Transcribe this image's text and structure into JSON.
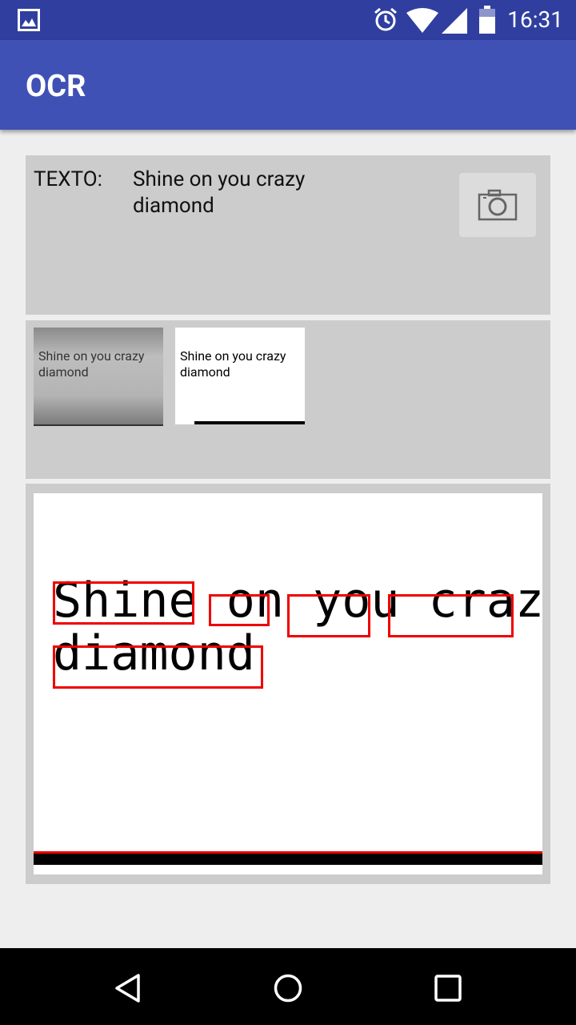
{
  "status_bar": {
    "time": "16:31",
    "icons": [
      "image-icon",
      "alarm-icon",
      "wifi-icon",
      "signal-icon",
      "battery-icon"
    ]
  },
  "app_bar": {
    "title": "OCR"
  },
  "result_panel": {
    "label": "TEXTO:",
    "text": "Shine on you crazy diamond",
    "camera_icon": "camera-icon"
  },
  "thumbnails": [
    {
      "name": "original-photo",
      "caption": "Shine on you crazy diamond"
    },
    {
      "name": "processed-image",
      "caption": "Shine on you crazy diamond"
    }
  ],
  "detection_image": {
    "words": [
      "Shine",
      "on",
      "you",
      "crazy",
      "diamond"
    ],
    "box_color": "#e00000"
  },
  "nav_bar": {
    "buttons": [
      "back-icon",
      "home-icon",
      "recents-icon"
    ]
  },
  "colors": {
    "primary": "#3f51b5",
    "primary_dark": "#303f9f",
    "panel": "#cccccc",
    "background": "#eeeeee"
  }
}
